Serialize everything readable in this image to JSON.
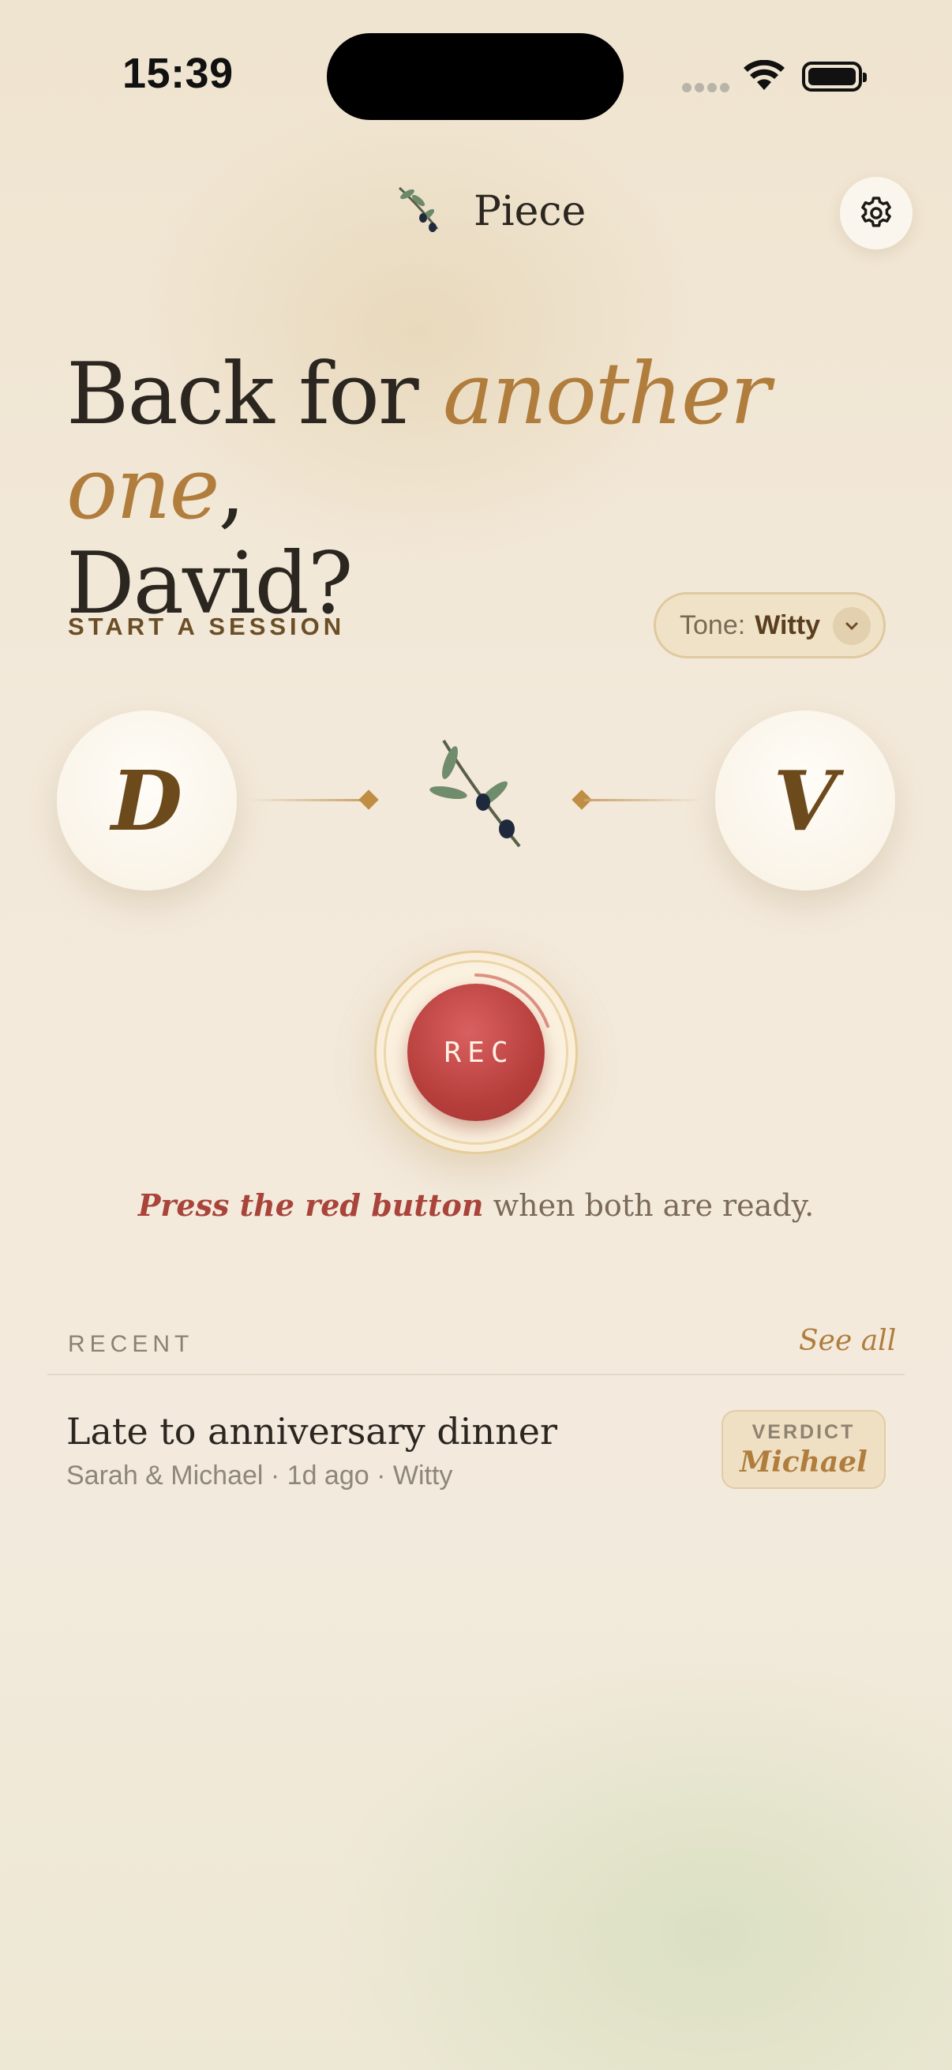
{
  "status_bar": {
    "time": "15:39"
  },
  "header": {
    "app_name": "Piece",
    "brand_icon": "olive-branch-icon",
    "settings_icon": "gear-icon"
  },
  "greeting": {
    "prefix": "Back for ",
    "accent": "another one",
    "suffix": ",",
    "name": "David?"
  },
  "session": {
    "label": "START A SESSION",
    "tone_label": "Tone:",
    "tone_value": "Witty",
    "participants": [
      {
        "initial": "D"
      },
      {
        "initial": "V"
      }
    ]
  },
  "record": {
    "button_label": "REC"
  },
  "hint": {
    "emphasis": "Press the red button",
    "rest": " when both are ready."
  },
  "recent": {
    "label": "RECENT",
    "see_all": "See all",
    "items": [
      {
        "title": "Late to anniversary dinner",
        "meta": "Sarah & Michael · 1d ago · Witty",
        "verdict_label": "VERDICT",
        "verdict_name": "Michael"
      }
    ]
  },
  "colors": {
    "accent": "#b07d3c",
    "record": "#b73f3c",
    "background": "#f3e9da"
  }
}
